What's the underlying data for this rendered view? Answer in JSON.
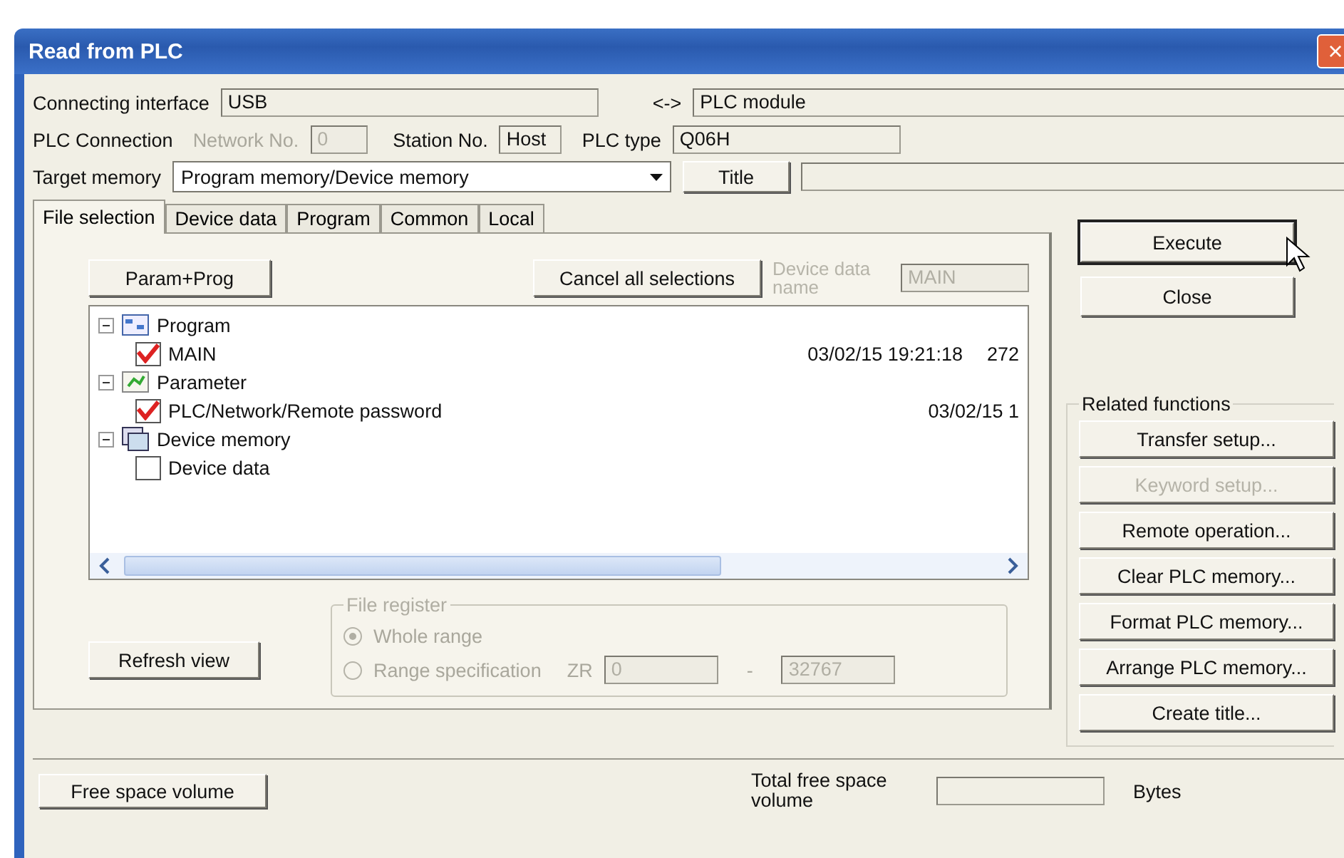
{
  "window": {
    "title": "Read from PLC",
    "close": "×"
  },
  "connection": {
    "interface_label": "Connecting interface",
    "interface_value": "USB",
    "arrow": "<->",
    "module_value": "PLC module"
  },
  "plc_connection": {
    "label": "PLC Connection",
    "network_label": "Network No.",
    "network_value": "0",
    "network_disabled": true,
    "station_label": "Station No.",
    "station_value": "Host",
    "plc_type_label": "PLC type",
    "plc_type_value": "Q06H"
  },
  "target_memory": {
    "label": "Target memory",
    "value": "Program memory/Device memory",
    "title_button": "Title"
  },
  "tabs": [
    {
      "label": "File selection",
      "selected": true
    },
    {
      "label": "Device data",
      "selected": false
    },
    {
      "label": "Program",
      "selected": false
    },
    {
      "label": "Common",
      "selected": false
    },
    {
      "label": "Local",
      "selected": false
    }
  ],
  "panel": {
    "param_prog_button": "Param+Prog",
    "cancel_button": "Cancel all selections",
    "device_data_name_label": "Device data name",
    "device_data_name_value": "MAIN",
    "device_data_name_disabled": true,
    "tree": [
      {
        "label": "Program",
        "kind": "program",
        "expanded": true,
        "children": [
          {
            "label": "MAIN",
            "checked": true,
            "date": "03/02/15 19:21:18",
            "size": "272"
          }
        ]
      },
      {
        "label": "Parameter",
        "kind": "parameter",
        "expanded": true,
        "children": [
          {
            "label": "PLC/Network/Remote password",
            "checked": true,
            "date": "03/02/15 1"
          }
        ]
      },
      {
        "label": "Device memory",
        "kind": "device",
        "expanded": true,
        "children": [
          {
            "label": "Device data",
            "checked": false
          }
        ]
      }
    ],
    "refresh_button": "Refresh view",
    "file_register": {
      "legend": "File register",
      "disabled": true,
      "options": [
        {
          "label": "Whole range",
          "selected": true
        },
        {
          "label": "Range specification",
          "selected": false
        }
      ],
      "device": "ZR",
      "from": "0",
      "dash": "-",
      "to": "32767"
    }
  },
  "actions": [
    {
      "label": "Execute",
      "focused": true
    },
    {
      "label": "Close",
      "focused": false
    }
  ],
  "related": {
    "legend": "Related functions",
    "buttons": [
      {
        "label": "Transfer setup...",
        "disabled": false
      },
      {
        "label": "Keyword setup...",
        "disabled": true
      },
      {
        "label": "Remote operation...",
        "disabled": false
      },
      {
        "label": "Clear PLC memory...",
        "disabled": false
      },
      {
        "label": "Format PLC memory...",
        "disabled": false
      },
      {
        "label": "Arrange PLC memory...",
        "disabled": false
      },
      {
        "label": "Create title...",
        "disabled": false
      }
    ]
  },
  "footer": {
    "free_space_button": "Free space volume",
    "total_label": "Total free space volume",
    "unit": "Bytes"
  }
}
